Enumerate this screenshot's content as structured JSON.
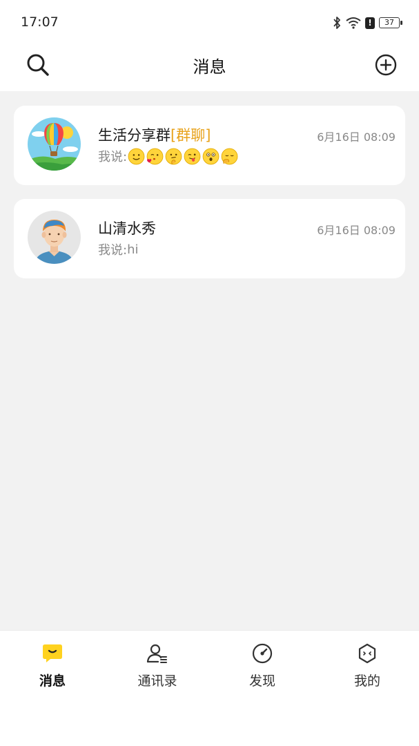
{
  "status_bar": {
    "time": "17:07",
    "battery": "37"
  },
  "header": {
    "title": "消息",
    "search_icon": "search-icon",
    "add_icon": "plus-circle-icon"
  },
  "conversations": [
    {
      "name": "生活分享群",
      "tag": "[群聊]",
      "time": "6月16日 08:09",
      "preview_prefix": "我说:",
      "preview_text": "",
      "emojis": [
        "smile-emoji",
        "kiss-emoji",
        "thinking-emoji",
        "tongue-emoji",
        "surprised-emoji",
        "sleepy-emoji"
      ],
      "avatar": "hot-air-balloon-avatar"
    },
    {
      "name": "山清水秀",
      "tag": "",
      "time": "6月16日 08:09",
      "preview_prefix": "我说:",
      "preview_text": "hi",
      "emojis": [],
      "avatar": "cartoon-man-avatar"
    }
  ],
  "tabbar": {
    "items": [
      {
        "label": "消息",
        "icon": "chat-bubble-icon",
        "active": true
      },
      {
        "label": "通讯录",
        "icon": "contacts-icon",
        "active": false
      },
      {
        "label": "发现",
        "icon": "compass-icon",
        "active": false
      },
      {
        "label": "我的",
        "icon": "profile-hexagon-icon",
        "active": false
      }
    ]
  },
  "colors": {
    "accent": "#ffd21f",
    "group_tag": "#e8a21a",
    "background": "#f2f2f2"
  }
}
